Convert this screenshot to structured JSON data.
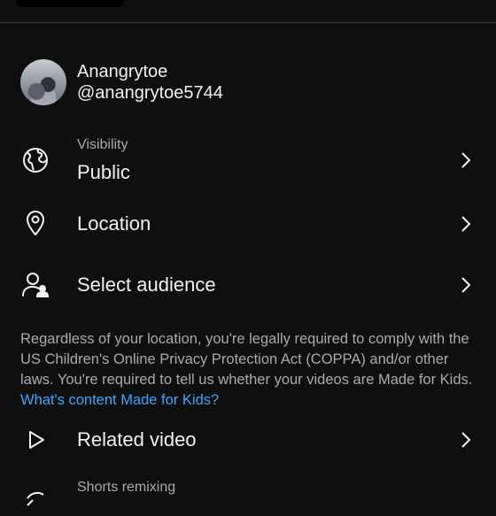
{
  "account": {
    "name": "Anangrytoe",
    "handle": "@anangrytoe5744"
  },
  "rows": {
    "visibility": {
      "label": "Visibility",
      "value": "Public",
      "icon": "globe-icon"
    },
    "location": {
      "label": "Location",
      "icon": "location-pin-icon"
    },
    "audience": {
      "label": "Select audience",
      "icon": "audience-icon"
    },
    "related": {
      "label": "Related video",
      "icon": "play-outline-icon"
    },
    "remixing": {
      "label": "Shorts remixing",
      "icon": "remix-icon"
    }
  },
  "notice": {
    "text": "Regardless of your location, you're legally required to comply with the US Children's Online Privacy Protection Act (COPPA) and/or other laws. You're required to tell us whether your videos are Made for Kids.",
    "link": "What's content Made for Kids?"
  },
  "colors": {
    "background": "#0f0f0f",
    "text": "#f1f1f1",
    "secondary_text": "#aaaaaa",
    "link": "#3ea6ff",
    "divider": "#3a3a3a"
  }
}
